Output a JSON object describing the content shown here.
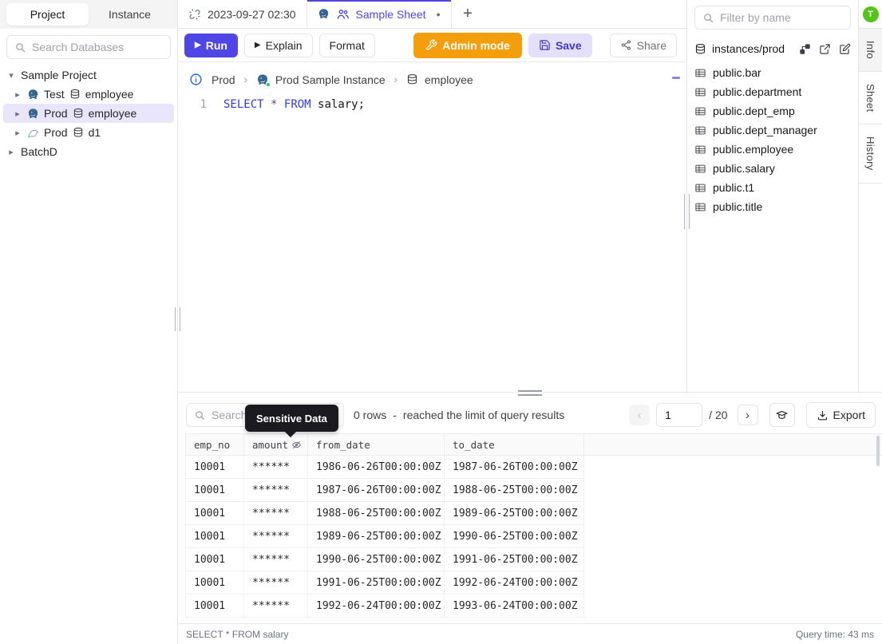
{
  "icons": {
    "caret_down": "▾",
    "caret_right": "▸",
    "play": "▶",
    "plus": "+",
    "unsaved_dot": "●",
    "breadcrumb_sep": "›",
    "chev_left": "‹",
    "chev_right": "›"
  },
  "sidebar": {
    "tabs": [
      "Project",
      "Instance"
    ],
    "search_placeholder": "Search Databases",
    "tree": {
      "project1": "Sample Project",
      "items": [
        {
          "env": "Test",
          "db": "employee"
        },
        {
          "env": "Prod",
          "db": "employee"
        },
        {
          "env": "Prod",
          "db": "d1"
        }
      ],
      "project2": "BatchD"
    }
  },
  "tabs": {
    "tab1": "2023-09-27 02:30",
    "tab2": "Sample Sheet"
  },
  "toolbar": {
    "run": "Run",
    "explain": "Explain",
    "format": "Format",
    "admin_mode": "Admin mode",
    "save": "Save",
    "share": "Share"
  },
  "breadcrumb": {
    "environment": "Prod",
    "instance": "Prod Sample Instance",
    "database": "employee"
  },
  "editor": {
    "line_number": "1",
    "kw_select": "SELECT",
    "star": "*",
    "kw_from": "FROM",
    "rest": " salary;"
  },
  "right_panel": {
    "filter_placeholder": "Filter by name",
    "instance_path": "instances/prod",
    "tables": [
      "public.bar",
      "public.department",
      "public.dept_emp",
      "public.dept_manager",
      "public.employee",
      "public.salary",
      "public.t1",
      "public.title"
    ]
  },
  "side_tabs": {
    "avatar": "T",
    "info": "Info",
    "sheet": "Sheet",
    "history": "History"
  },
  "results": {
    "search_placeholder": "Search",
    "tooltip": "Sensitive Data",
    "row_count": "0 rows",
    "separator": "-",
    "limit_message": "reached the limit of query results",
    "page_current": "1",
    "page_total": "/ 20",
    "export_label": "Export",
    "columns": [
      "emp_no",
      "amount",
      "from_date",
      "to_date"
    ],
    "rows": [
      [
        "10001",
        "******",
        "1986-06-26T00:00:00Z",
        "1987-06-26T00:00:00Z"
      ],
      [
        "10001",
        "******",
        "1987-06-26T00:00:00Z",
        "1988-06-25T00:00:00Z"
      ],
      [
        "10001",
        "******",
        "1988-06-25T00:00:00Z",
        "1989-06-25T00:00:00Z"
      ],
      [
        "10001",
        "******",
        "1989-06-25T00:00:00Z",
        "1990-06-25T00:00:00Z"
      ],
      [
        "10001",
        "******",
        "1990-06-25T00:00:00Z",
        "1991-06-25T00:00:00Z"
      ],
      [
        "10001",
        "******",
        "1991-06-25T00:00:00Z",
        "1992-06-24T00:00:00Z"
      ],
      [
        "10001",
        "******",
        "1992-06-24T00:00:00Z",
        "1993-06-24T00:00:00Z"
      ]
    ],
    "status_query": "SELECT * FROM salary",
    "query_time": "Query time: 43 ms"
  },
  "colors": {
    "accent": "#4f46e5",
    "admin_orange": "#f59e0b",
    "avatar_green": "#52c41a",
    "keyword_blue": "#2d3be8",
    "tooltip_bg": "#1b1b1f",
    "selected_tree_bg": "#e9e5fb",
    "postgres_blue": "#336791",
    "mysql_teal": "#4a90a4",
    "status_green": "#22c55e"
  }
}
